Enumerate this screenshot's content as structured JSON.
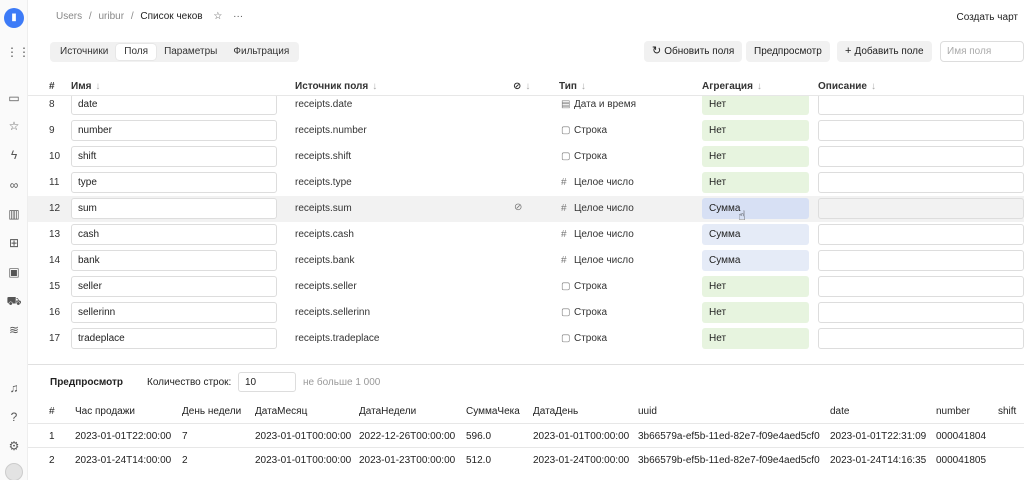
{
  "breadcrumbs": {
    "root": "Users",
    "folder": "uribur",
    "current": "Список чеков"
  },
  "header": {
    "create_chart": "Создать чарт"
  },
  "toolbar": {
    "tabs": [
      {
        "label": "Источники",
        "active": false
      },
      {
        "label": "Поля",
        "active": true
      },
      {
        "label": "Параметры",
        "active": false
      },
      {
        "label": "Фильтрация",
        "active": false
      }
    ],
    "refresh_fields": "Обновить поля",
    "preview": "Предпросмотр",
    "add_field": "Добавить поле",
    "search_placeholder": "Имя поля"
  },
  "fields_table": {
    "columns": {
      "num": "#",
      "name": "Имя",
      "source": "Источник поля",
      "type": "Тип",
      "aggregation": "Агрегация",
      "description": "Описание"
    },
    "rows": [
      {
        "num": "8",
        "name": "date",
        "source": "receipts.date",
        "type": "Дата и время",
        "type_icon": "calendar-icon",
        "aggregation": "Нет",
        "hidden": false
      },
      {
        "num": "9",
        "name": "number",
        "source": "receipts.number",
        "type": "Строка",
        "type_icon": "string-icon",
        "aggregation": "Нет",
        "hidden": false
      },
      {
        "num": "10",
        "name": "shift",
        "source": "receipts.shift",
        "type": "Строка",
        "type_icon": "string-icon",
        "aggregation": "Нет",
        "hidden": false
      },
      {
        "num": "11",
        "name": "type",
        "source": "receipts.type",
        "type": "Целое число",
        "type_icon": "hash-icon",
        "aggregation": "Нет",
        "hidden": false
      },
      {
        "num": "12",
        "name": "sum",
        "source": "receipts.sum",
        "type": "Целое число",
        "type_icon": "hash-icon",
        "aggregation": "Сумма",
        "hidden": true
      },
      {
        "num": "13",
        "name": "cash",
        "source": "receipts.cash",
        "type": "Целое число",
        "type_icon": "hash-icon",
        "aggregation": "Сумма",
        "hidden": false
      },
      {
        "num": "14",
        "name": "bank",
        "source": "receipts.bank",
        "type": "Целое число",
        "type_icon": "hash-icon",
        "aggregation": "Сумма",
        "hidden": false
      },
      {
        "num": "15",
        "name": "seller",
        "source": "receipts.seller",
        "type": "Строка",
        "type_icon": "string-icon",
        "aggregation": "Нет",
        "hidden": false
      },
      {
        "num": "16",
        "name": "sellerinn",
        "source": "receipts.sellerinn",
        "type": "Строка",
        "type_icon": "string-icon",
        "aggregation": "Нет",
        "hidden": false
      },
      {
        "num": "17",
        "name": "tradeplace",
        "source": "receipts.tradeplace",
        "type": "Строка",
        "type_icon": "string-icon",
        "aggregation": "Нет",
        "hidden": false
      }
    ]
  },
  "preview": {
    "title": "Предпросмотр",
    "row_count_label": "Количество строк:",
    "row_count_value": "10",
    "limit_hint": "не больше 1 000",
    "columns": [
      "#",
      "Час продажи",
      "День недели",
      "ДатаМесяц",
      "ДатаНедели",
      "СуммаЧека",
      "ДатаДень",
      "uuid",
      "date",
      "number",
      "shift"
    ],
    "rows": [
      [
        "1",
        "2023-01-01T22:00:00",
        "7",
        "2023-01-01T00:00:00",
        "2022-12-26T00:00:00",
        "596.0",
        "2023-01-01T00:00:00",
        "3b66579a-ef5b-11ed-82e7-f09e4aed5cf0",
        "2023-01-01T22:31:09",
        "000041804",
        ""
      ],
      [
        "2",
        "2023-01-24T14:00:00",
        "2",
        "2023-01-01T00:00:00",
        "2023-01-23T00:00:00",
        "512.0",
        "2023-01-24T00:00:00",
        "3b66579b-ef5b-11ed-82e7-f09e4aed5cf0",
        "2023-01-24T14:16:35",
        "000041805",
        ""
      ]
    ]
  }
}
